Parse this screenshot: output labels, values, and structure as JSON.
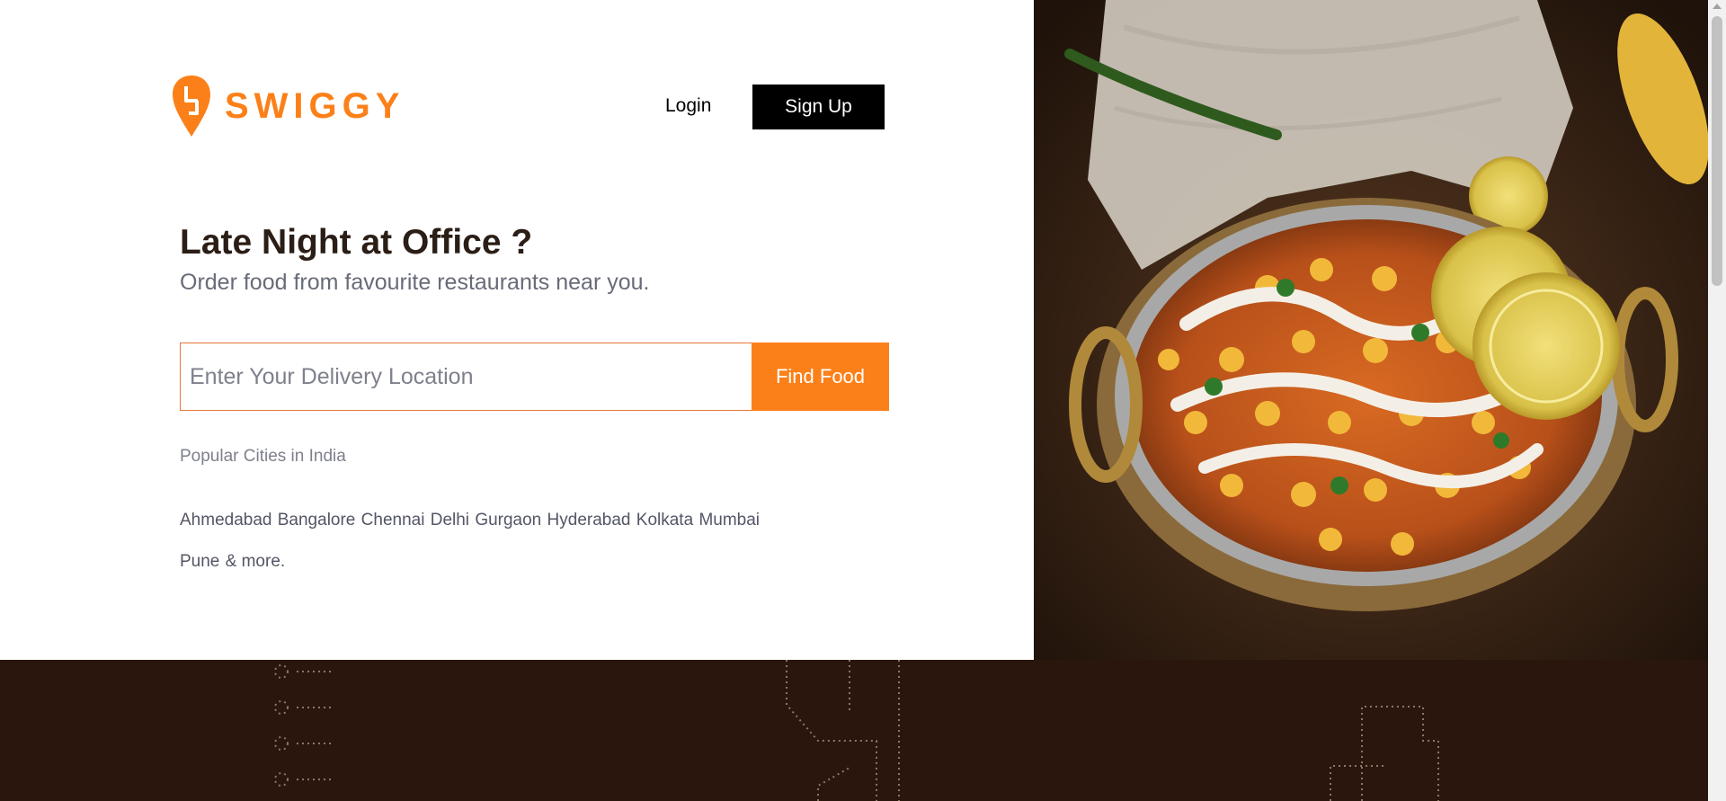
{
  "brand": {
    "name": "SWIGGY",
    "accent": "#fc8019"
  },
  "header": {
    "login_label": "Login",
    "signup_label": "Sign Up"
  },
  "hero": {
    "headline": "Late Night at Office ?",
    "subheadline": "Order food from favourite restaurants near you.",
    "search": {
      "placeholder": "Enter Your Delivery Location",
      "value": "",
      "button_label": "Find Food"
    }
  },
  "cities": {
    "label": "Popular Cities in India",
    "items": [
      "Ahmedabad",
      "Bangalore",
      "Chennai",
      "Delhi",
      "Gurgaon",
      "Hyderabad",
      "Kolkata",
      "Mumbai",
      "Pune"
    ],
    "more": "& more."
  },
  "colors": {
    "footer_bg": "#2a160c",
    "button_dark": "#000000"
  }
}
